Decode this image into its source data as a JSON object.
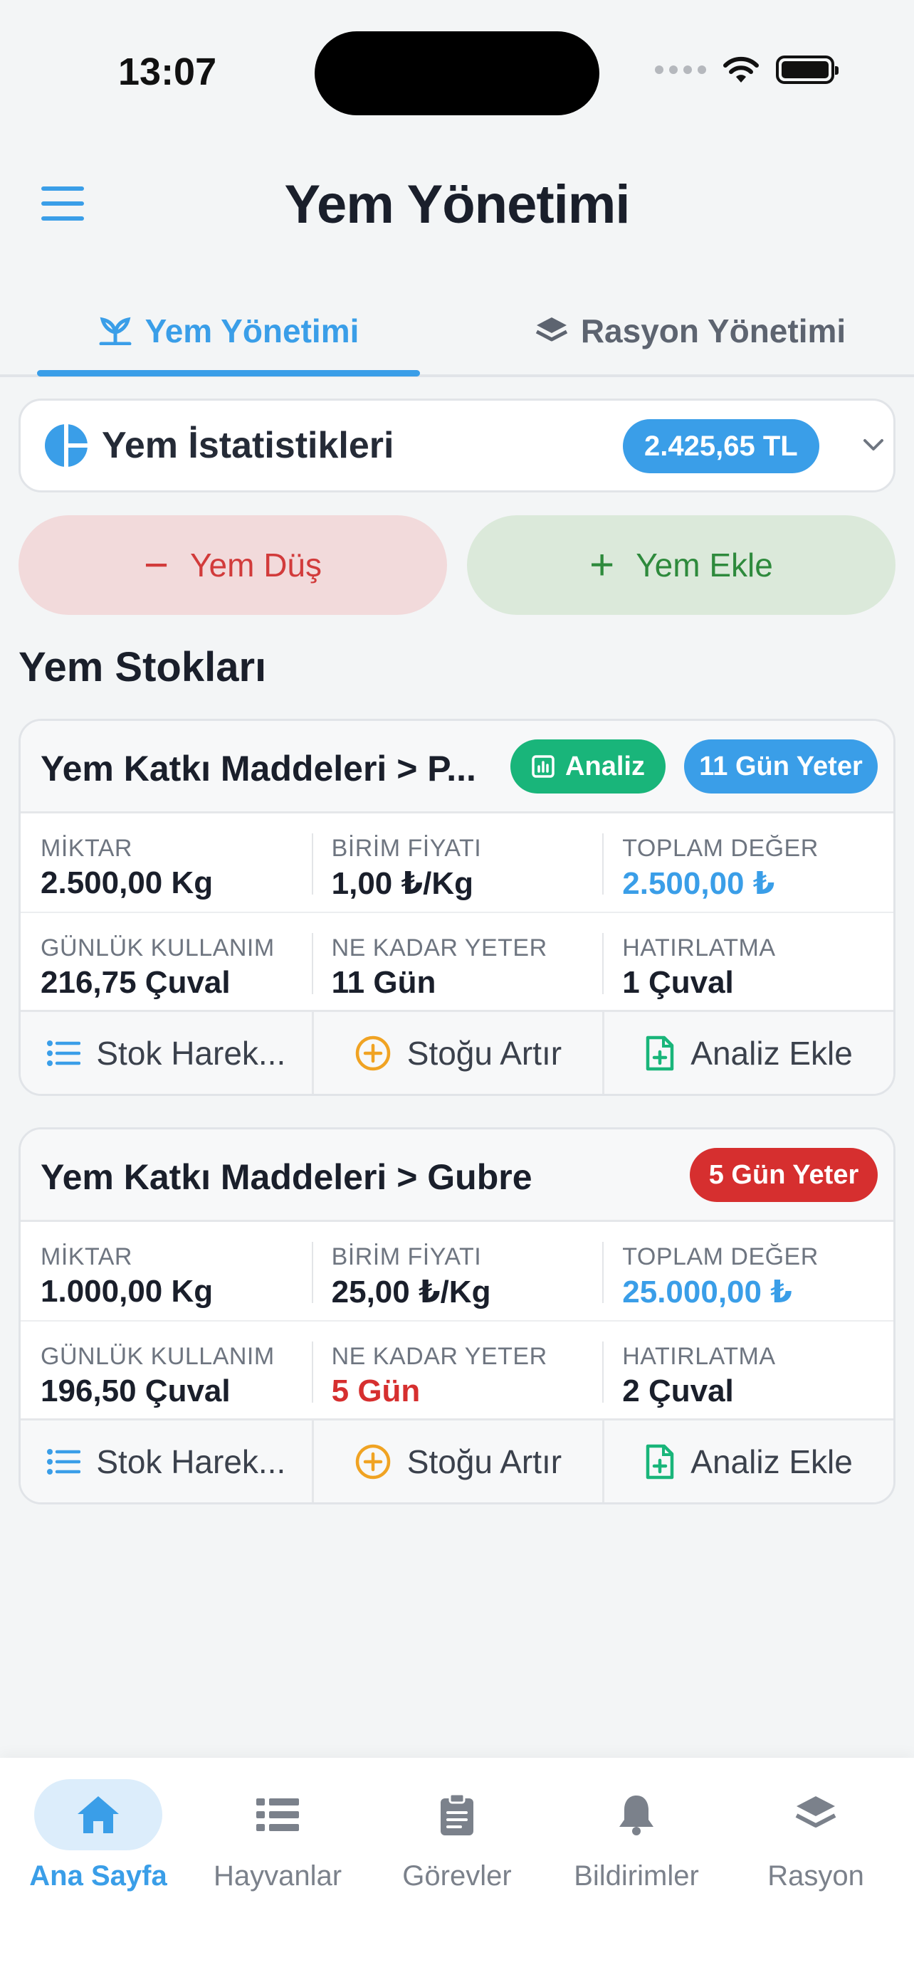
{
  "status": {
    "time": "13:07"
  },
  "header": {
    "title": "Yem Yönetimi"
  },
  "tabs": [
    {
      "label": "Yem Yönetimi",
      "active": true
    },
    {
      "label": "Rasyon Yönetimi",
      "active": false
    }
  ],
  "stats": {
    "title": "Yem İstatistikleri",
    "badge": "2.425,65 TL"
  },
  "actions": {
    "minus_label": "Yem Düş",
    "plus_label": "Yem Ekle"
  },
  "section_title": "Yem Stokları",
  "cards": [
    {
      "name": "Yem Katkı Maddeleri > P...",
      "analiz_chip": "Analiz",
      "status_chip": "11 Gün Yeter",
      "status_color": "#3a9ee8",
      "cells": [
        {
          "label": "MİKTAR",
          "value": "2.500,00 Kg"
        },
        {
          "label": "BİRİM FİYATI",
          "value": "1,00 ₺/Kg"
        },
        {
          "label": "TOPLAM DEĞER",
          "value": "2.500,00 ₺"
        },
        {
          "label": "GÜNLÜK KULLANIM",
          "value": "216,75 Çuval"
        },
        {
          "label": "NE KADAR YETER",
          "value": "11 Gün"
        },
        {
          "label": "HATIRLATMA",
          "value": "1 Çuval"
        }
      ],
      "footer": [
        "Stok Harek...",
        "Stoğu Artır",
        "Analiz Ekle"
      ]
    },
    {
      "name": "Yem Katkı Maddeleri > Gubre",
      "status_chip": "5 Gün Yeter",
      "status_color": "#d62f2f",
      "cells": [
        {
          "label": "MİKTAR",
          "value": "1.000,00 Kg"
        },
        {
          "label": "BİRİM FİYATI",
          "value": "25,00 ₺/Kg"
        },
        {
          "label": "TOPLAM DEĞER",
          "value": "25.000,00 ₺"
        },
        {
          "label": "GÜNLÜK KULLANIM",
          "value": "196,50 Çuval"
        },
        {
          "label": "NE KADAR YETER",
          "value": "5 Gün"
        },
        {
          "label": "HATIRLATMA",
          "value": "2 Çuval"
        }
      ],
      "footer": [
        "Stok Harek...",
        "Stoğu Artır",
        "Analiz Ekle"
      ]
    }
  ],
  "nav": [
    {
      "label": "Ana Sayfa",
      "icon": "home-icon",
      "active": true
    },
    {
      "label": "Hayvanlar",
      "icon": "list-icon",
      "active": false
    },
    {
      "label": "Görevler",
      "icon": "clipboard-icon",
      "active": false
    },
    {
      "label": "Bildirimler",
      "icon": "bell-icon",
      "active": false
    },
    {
      "label": "Rasyon",
      "icon": "layers-icon",
      "active": false
    }
  ],
  "colors": {
    "accent": "#3a9ee8",
    "danger": "#d62f2f",
    "success": "#19b57a"
  }
}
